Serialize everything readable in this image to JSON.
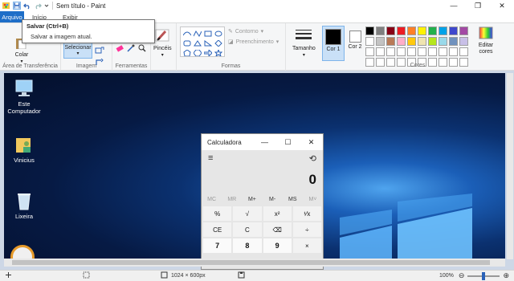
{
  "window": {
    "title": "Sem título - Paint",
    "minimize_icon": "minimize-icon",
    "maximize_icon": "maximize-icon",
    "close_icon": "close-icon"
  },
  "tabs": [
    {
      "label": "Arquivo"
    },
    {
      "label": "Início"
    },
    {
      "label": "Exibir"
    }
  ],
  "tooltip": {
    "title": "Salvar (Ctrl+B)",
    "description": "Salvar a imagem atual."
  },
  "ribbon": {
    "clipboard": {
      "paste_label": "Colar",
      "group_label": "Área de Transferência"
    },
    "image": {
      "select_label": "Selecionar",
      "group_label": "Imagem"
    },
    "tools": {
      "group_label": "Ferramentas"
    },
    "brushes": {
      "label": "Pincéis"
    },
    "shapes": {
      "outline_label": "Contorno",
      "fill_label": "Preenchimento",
      "group_label": "Formas"
    },
    "size": {
      "label": "Tamanho"
    },
    "color1": {
      "label": "Cor 1",
      "value": "#000000"
    },
    "color2": {
      "label": "Cor 2",
      "value": "#ffffff"
    },
    "colors_group_label": "Cores",
    "edit_colors_label": "Editar cores",
    "palette": [
      "#000000",
      "#7f7f7f",
      "#880015",
      "#ed1c24",
      "#ff7f27",
      "#fff200",
      "#22b14c",
      "#00a2e8",
      "#3f48cc",
      "#a349a4",
      "#ffffff",
      "#c3c3c3",
      "#b97a57",
      "#ffaec9",
      "#ffc90e",
      "#efe4b0",
      "#b5e61d",
      "#99d9ea",
      "#7092be",
      "#c8bfe7",
      "#ffffff",
      "#ffffff",
      "#ffffff",
      "#ffffff",
      "#ffffff",
      "#ffffff",
      "#ffffff",
      "#ffffff",
      "#ffffff",
      "#ffffff",
      "#ffffff",
      "#ffffff",
      "#ffffff",
      "#ffffff",
      "#ffffff",
      "#ffffff",
      "#ffffff",
      "#ffffff",
      "#ffffff",
      "#ffffff"
    ]
  },
  "desktop": {
    "icons": [
      {
        "label": "Este Computador",
        "icon": "computer-icon"
      },
      {
        "label": "Vinicius",
        "icon": "user-folder-icon"
      },
      {
        "label": "Lixeira",
        "icon": "recycle-bin-icon"
      }
    ]
  },
  "calculator": {
    "title": "Calculadora",
    "display": "0",
    "memory": [
      "MC",
      "MR",
      "M+",
      "M-",
      "MS",
      "M˅"
    ],
    "keys": [
      "%",
      "√",
      "x²",
      "¹⁄x",
      "CE",
      "C",
      "⌫",
      "÷",
      "7",
      "8",
      "9",
      "×"
    ]
  },
  "status": {
    "dimensions": "1024 × 600px",
    "zoom": "100%"
  }
}
